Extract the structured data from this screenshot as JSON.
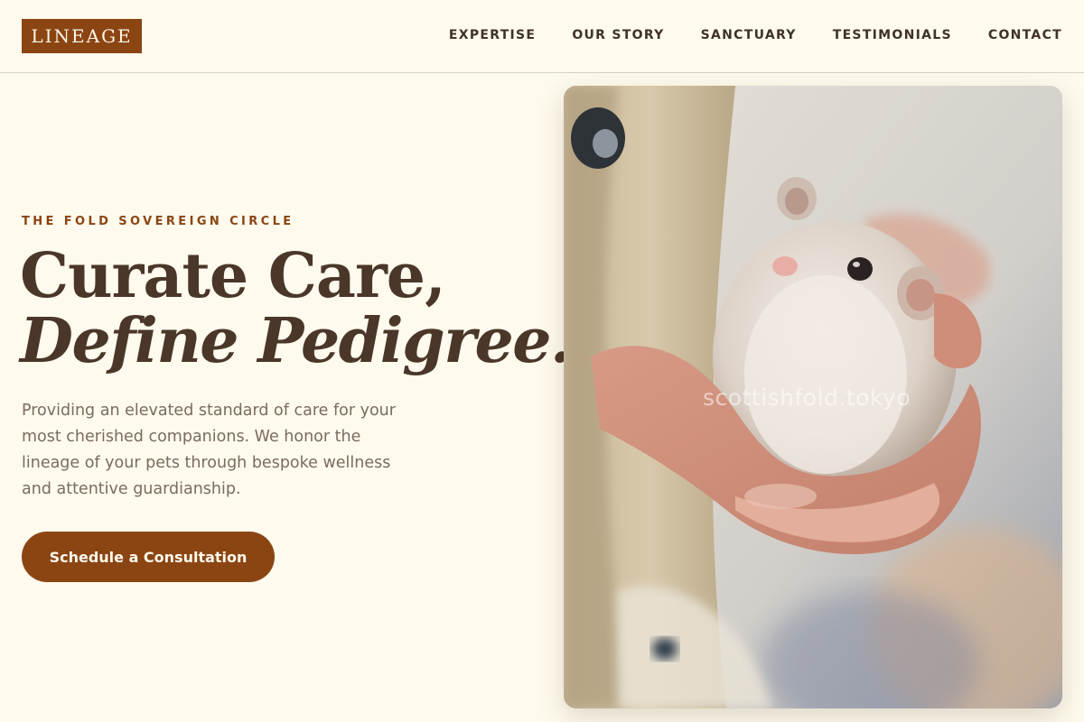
{
  "brand": {
    "logo_text": "LINEAGE"
  },
  "nav": {
    "items": [
      {
        "label": "EXPERTISE"
      },
      {
        "label": "OUR STORY"
      },
      {
        "label": "SANCTUARY"
      },
      {
        "label": "TESTIMONIALS"
      },
      {
        "label": "CONTACT"
      }
    ]
  },
  "hero": {
    "eyebrow": "THE FOLD SOVEREIGN CIRCLE",
    "headline_line1": "Curate Care,",
    "headline_line2": "Define Pedigree.",
    "lead": "Providing an elevated standard of care for your most cherished companions. We honor the lineage of your pets through bespoke wellness and attentive guardianship.",
    "cta_label": "Schedule a Consultation"
  },
  "photo": {
    "watermark": "scottishfold.tokyo"
  },
  "colors": {
    "background": "#fefaed",
    "accent": "#8b4513",
    "text": "#4a3729",
    "muted_text": "#7a6c5f"
  }
}
